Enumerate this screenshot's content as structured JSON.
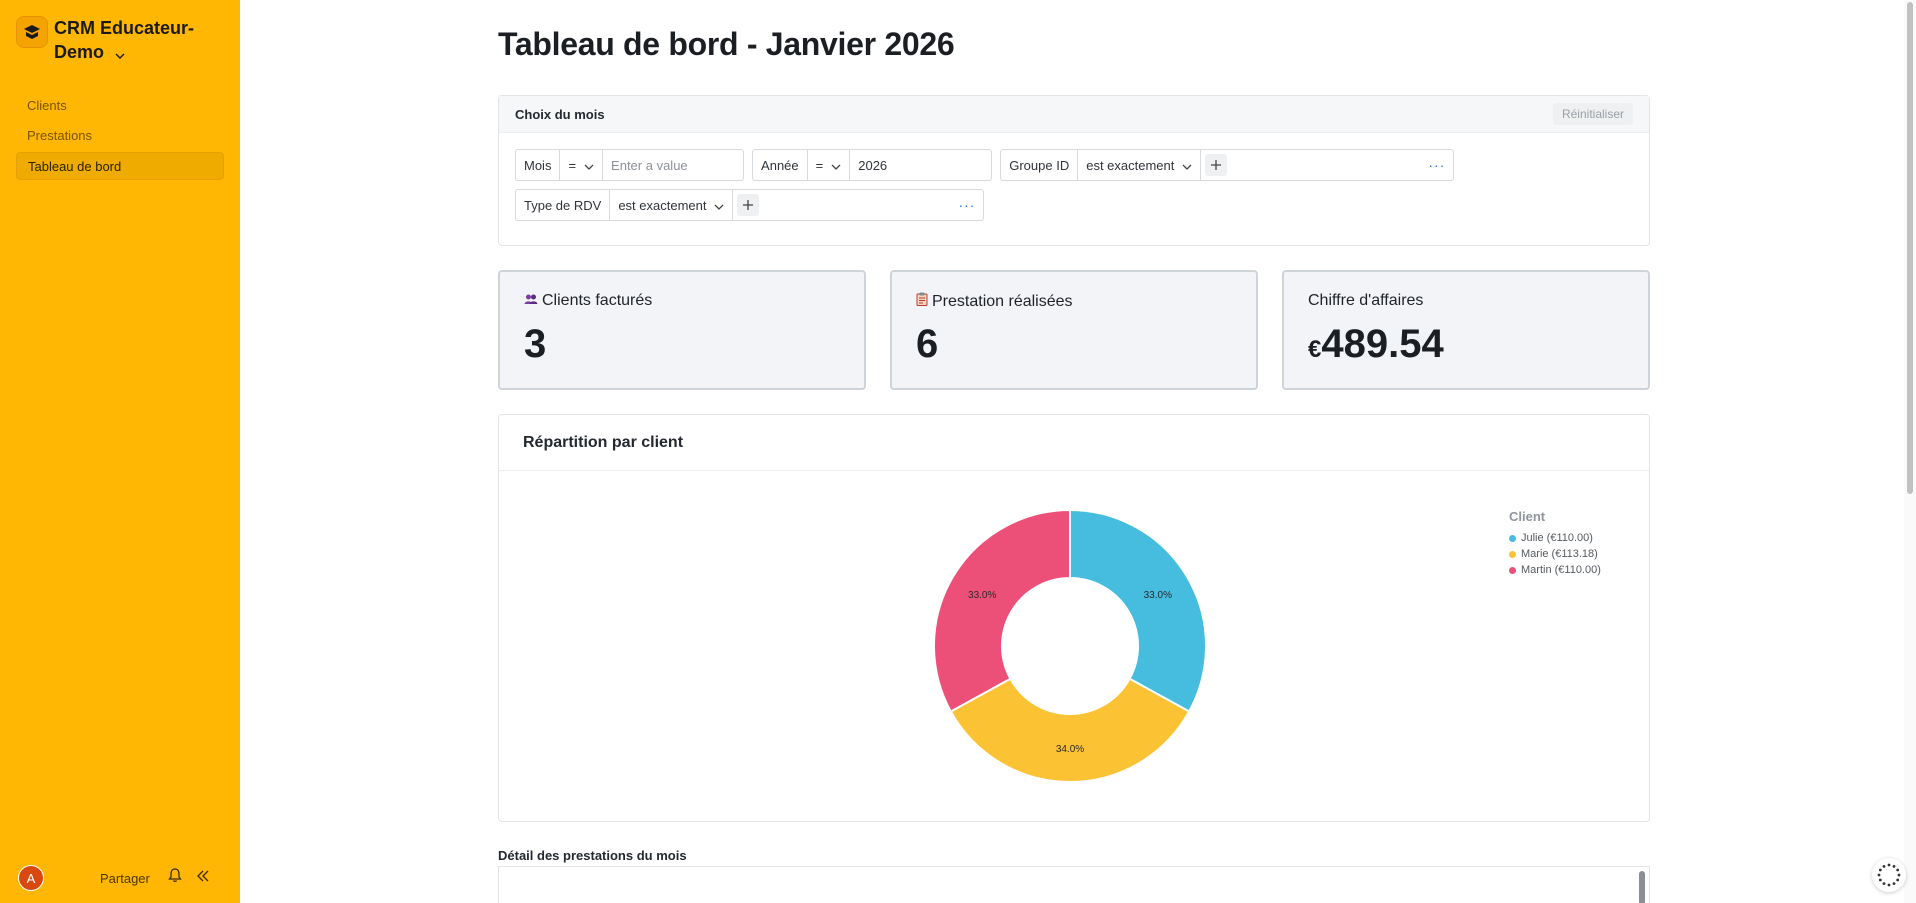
{
  "app": {
    "name": "CRM Educateur-Demo"
  },
  "sidebar": {
    "items": [
      {
        "label": "Clients",
        "active": false
      },
      {
        "label": "Prestations",
        "active": false
      },
      {
        "label": "Tableau de bord",
        "active": true
      }
    ],
    "avatar_initial": "A",
    "share_label": "Partager"
  },
  "page": {
    "title": "Tableau de bord - Janvier 2026"
  },
  "filters": {
    "title": "Choix du mois",
    "reset_label": "Réinitialiser",
    "mois": {
      "label": "Mois",
      "operator": "=",
      "placeholder": "Enter a value"
    },
    "annee": {
      "label": "Année",
      "operator": "=",
      "value": "2026"
    },
    "groupe": {
      "label": "Groupe ID",
      "operator": "est exactement"
    },
    "type_rdv": {
      "label": "Type de RDV",
      "operator": "est exactement"
    }
  },
  "stats": {
    "clients": {
      "label": "Clients facturés",
      "value": "3"
    },
    "prestations": {
      "label": "Prestation réalisées",
      "value": "6"
    },
    "ca": {
      "label": "Chiffre d'affaires",
      "currency": "€",
      "value": "489.54"
    }
  },
  "chart_card": {
    "title": "Répartition par client"
  },
  "chart_data": {
    "type": "pie",
    "donut": true,
    "legend_title": "Client",
    "legend_position": "top-right",
    "slices": [
      {
        "name": "Julie (€110.00)",
        "value": 33.0,
        "label": "33.0%",
        "color": "#46bddf"
      },
      {
        "name": "Marie (€113.18)",
        "value": 34.0,
        "label": "34.0%",
        "color": "#fbc233"
      },
      {
        "name": "Martin (€110.00)",
        "value": 33.0,
        "label": "33.0%",
        "color": "#ec5078"
      }
    ]
  },
  "detail": {
    "title": "Détail des prestations du mois"
  },
  "colors": {
    "sidebar": "#ffb703",
    "accent": "#f0ab00"
  }
}
